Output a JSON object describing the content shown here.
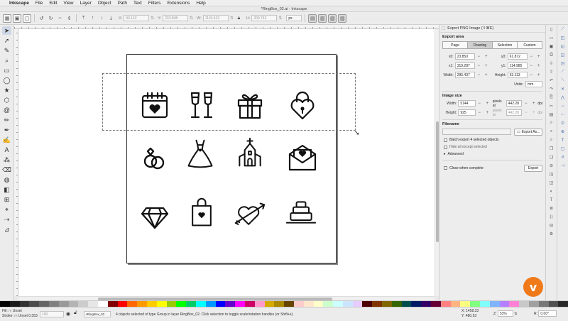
{
  "menubar": {
    "app_name": "Inkscape",
    "items": [
      "File",
      "Edit",
      "View",
      "Layer",
      "Object",
      "Path",
      "Text",
      "Filters",
      "Extensions",
      "Help"
    ]
  },
  "window": {
    "title": "*RingBox_02.ai - Inkscape"
  },
  "toolbar": {
    "x_label": "X:",
    "x_value": "90.142",
    "y_label": "Y:",
    "y_value": "233.848",
    "w_label": "W:",
    "w_value": "1116.613",
    "h_label": "H:",
    "h_value": "200.742",
    "unit": "px"
  },
  "export_dialog": {
    "title": "Export PNG Image (⇧⌘E)",
    "export_area_label": "Export area",
    "area_tabs": [
      "Page",
      "Drawing",
      "Selection",
      "Custom"
    ],
    "selected_area_tab": "Drawing",
    "x0_label": "x0:",
    "x0": "23.850",
    "y0_label": "y0:",
    "y0": "61.872",
    "x1_label": "x1:",
    "x1": "319.287",
    "y1_label": "y1:",
    "y1": "114.985",
    "width_label": "Width:",
    "width": "295.437",
    "height_label": "Height:",
    "height": "53.113",
    "units_label": "Units:",
    "units": "mm",
    "image_size_label": "Image size",
    "px_width_label": "Width:",
    "px_width": "5144",
    "px_height_label": "Height:",
    "px_height": "925",
    "pixels_at": "pixels at",
    "dpi_x": "442.28",
    "dpi_y": "442.28",
    "dpi_unit": "dpi",
    "filename_label": "Filename",
    "export_as_button": "Export As...",
    "batch_export_label": "Batch export 4 selected objects",
    "hide_all_label": "Hide all except selected",
    "advanced_label": "Advanced",
    "close_when_complete_label": "Close when complete",
    "export_button": "Export"
  },
  "status": {
    "fill_label": "Fill:",
    "fill_value": "Unset",
    "stroke_label": "Stroke:",
    "stroke_value": "Unset",
    "stroke_width": "0.353",
    "opacity": "100",
    "layer": "•RingBox_02",
    "message": "4 objects selected of type Group in layer RingBox_02. Click selection to toggle scale/rotation handles (or Shift+s).",
    "cursor_x_label": "X:",
    "cursor_x": "1458.33",
    "cursor_y_label": "Y:",
    "cursor_y": "480.53",
    "zoom_label": "Z:",
    "zoom": "53%",
    "rotation_label": "R:",
    "rotation": "0.00°"
  },
  "watermark": {
    "letter": "v",
    "color": "#f07a1a"
  },
  "palette_colors": [
    "#000000",
    "#1a1a1a",
    "#333333",
    "#4d4d4d",
    "#666666",
    "#808080",
    "#999999",
    "#b3b3b3",
    "#cccccc",
    "#e6e6e6",
    "#ffffff",
    "#800000",
    "#ff0000",
    "#ff6600",
    "#ff9900",
    "#ffcc00",
    "#ffff00",
    "#99cc00",
    "#00ff00",
    "#00cc66",
    "#00ffff",
    "#0099ff",
    "#0000ff",
    "#6600cc",
    "#ff00ff",
    "#cc0066",
    "#ff99cc",
    "#d4aa00",
    "#aa8800",
    "#664400",
    "#ffcccc",
    "#ffe6cc",
    "#ffffcc",
    "#ccffcc",
    "#ccffff",
    "#cce6ff",
    "#e6ccff",
    "#4d0000",
    "#803300",
    "#806600",
    "#336600",
    "#004d4d",
    "#001a66",
    "#330066",
    "#660033",
    "#ff8080",
    "#ffb380",
    "#ffff80",
    "#80ff80",
    "#80ffff",
    "#80b3ff",
    "#b380ff",
    "#ff80d4",
    "#c8c8c8",
    "#a0a0a0",
    "#787878",
    "#505050",
    "#282828"
  ]
}
